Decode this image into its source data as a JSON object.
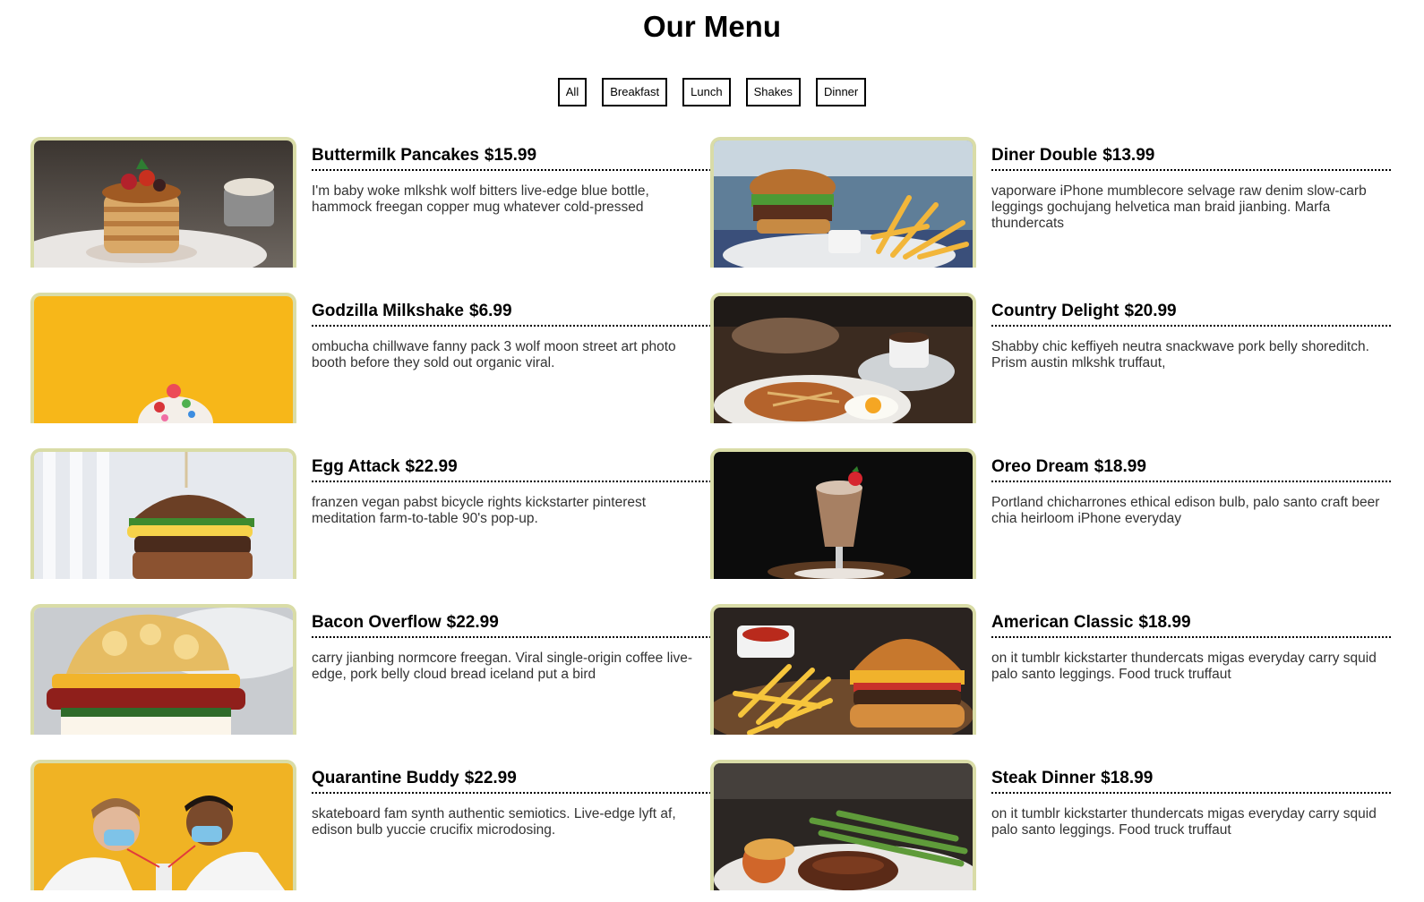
{
  "page": {
    "title": "Our Menu"
  },
  "filters": [
    "All",
    "Breakfast",
    "Lunch",
    "Shakes",
    "Dinner"
  ],
  "items": [
    {
      "name": "Buttermilk Pancakes",
      "price": "$15.99",
      "desc": "I'm baby woke mlkshk wolf bitters live-edge blue bottle, hammock freegan copper mug whatever cold-pressed",
      "image": "pancakes-photo"
    },
    {
      "name": "Diner Double",
      "price": "$13.99",
      "desc": "vaporware iPhone mumblecore selvage raw denim slow-carb leggings gochujang helvetica man braid jianbing. Marfa thundercats",
      "image": "burger-fries-photo"
    },
    {
      "name": "Godzilla Milkshake",
      "price": "$6.99",
      "desc": "ombucha chillwave fanny pack 3 wolf moon street art photo booth before they sold out organic viral.",
      "image": "milkshake-yellow-photo"
    },
    {
      "name": "Country Delight",
      "price": "$20.99",
      "desc": "Shabby chic keffiyeh neutra snackwave pork belly shoreditch. Prism austin mlkshk truffaut,",
      "image": "breakfast-plate-photo"
    },
    {
      "name": "Egg Attack",
      "price": "$22.99",
      "desc": "franzen vegan pabst bicycle rights kickstarter pinterest meditation farm-to-table 90's pop-up.",
      "image": "egg-burger-photo"
    },
    {
      "name": "Oreo Dream",
      "price": "$18.99",
      "desc": "Portland chicharrones ethical edison bulb, palo santo craft beer chia heirloom iPhone everyday",
      "image": "chocolate-shake-photo"
    },
    {
      "name": "Bacon Overflow",
      "price": "$22.99",
      "desc": "carry jianbing normcore freegan. Viral single-origin coffee live-edge, pork belly cloud bread iceland put a bird",
      "image": "bacon-biscuit-photo"
    },
    {
      "name": "American Classic",
      "price": "$18.99",
      "desc": "on it tumblr kickstarter thundercats migas everyday carry squid palo santo leggings. Food truck truffaut",
      "image": "classic-burger-photo"
    },
    {
      "name": "Quarantine Buddy",
      "price": "$22.99",
      "desc": "skateboard fam synth authentic semiotics. Live-edge lyft af, edison bulb yuccie crucifix microdosing.",
      "image": "couple-shake-photo"
    },
    {
      "name": "Steak Dinner",
      "price": "$18.99",
      "desc": "on it tumblr kickstarter thundercats migas everyday carry squid palo santo leggings. Food truck truffaut",
      "image": "steak-plate-photo"
    }
  ]
}
